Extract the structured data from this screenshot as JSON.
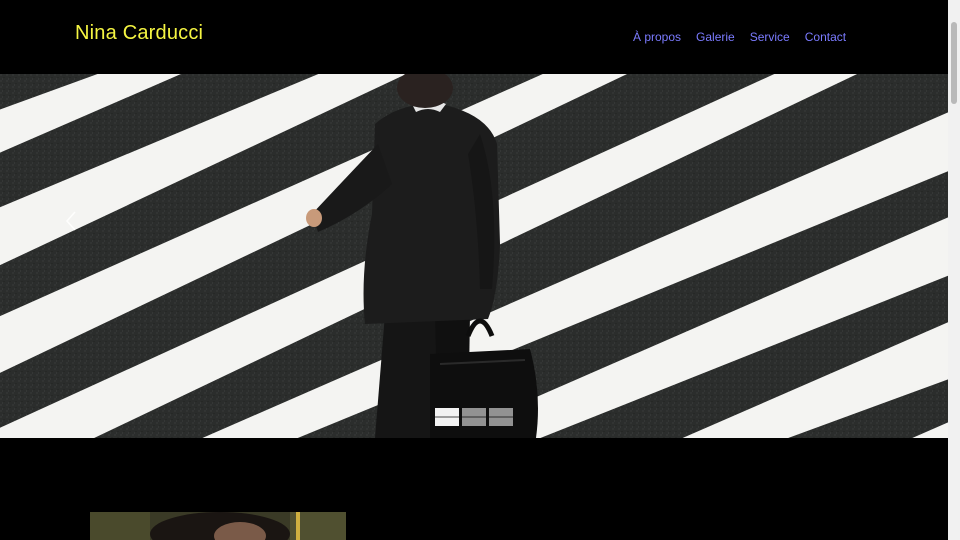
{
  "header": {
    "site_title": "Nina Carducci"
  },
  "nav": {
    "items": [
      {
        "label": "À propos"
      },
      {
        "label": "Galerie"
      },
      {
        "label": "Service"
      },
      {
        "label": "Contact"
      }
    ]
  },
  "carousel": {
    "slide_count": 3,
    "active_index": 0,
    "prev_icon": "chevron-left-icon"
  },
  "colors": {
    "title": "#f5f542",
    "nav_link": "#7b7bff",
    "background": "#000000"
  }
}
